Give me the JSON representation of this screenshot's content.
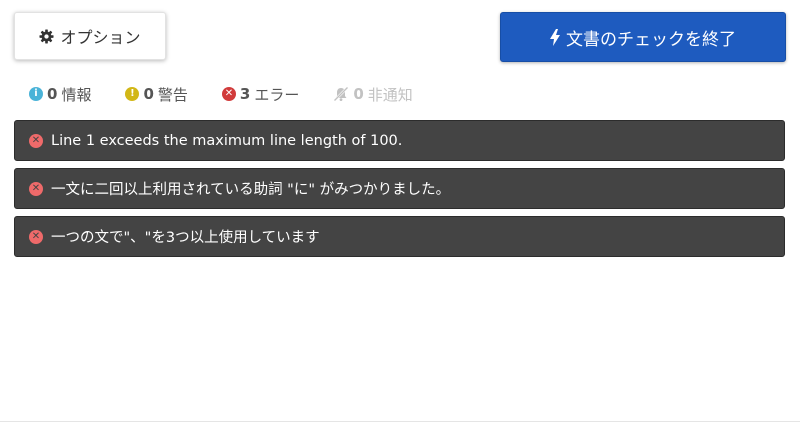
{
  "toolbar": {
    "options_label": "オプション",
    "finish_label": "文書のチェックを終了",
    "accent_color": "#1e5bbf"
  },
  "filters": {
    "info": {
      "count": "0",
      "label": "情報",
      "icon": "info-icon"
    },
    "warning": {
      "count": "0",
      "label": "警告",
      "icon": "warning-icon"
    },
    "error": {
      "count": "3",
      "label": "エラー",
      "icon": "error-icon"
    },
    "hidden": {
      "count": "0",
      "label": "非通知",
      "icon": "bell-off-icon"
    }
  },
  "messages": [
    {
      "text": "Line 1 exceeds the maximum line length of 100.",
      "icon": "error-icon"
    },
    {
      "text": "一文に二回以上利用されている助詞 \"に\" がみつかりました。",
      "icon": "error-icon"
    },
    {
      "text": "一つの文で\"、\"を3つ以上使用しています",
      "icon": "error-icon"
    }
  ]
}
